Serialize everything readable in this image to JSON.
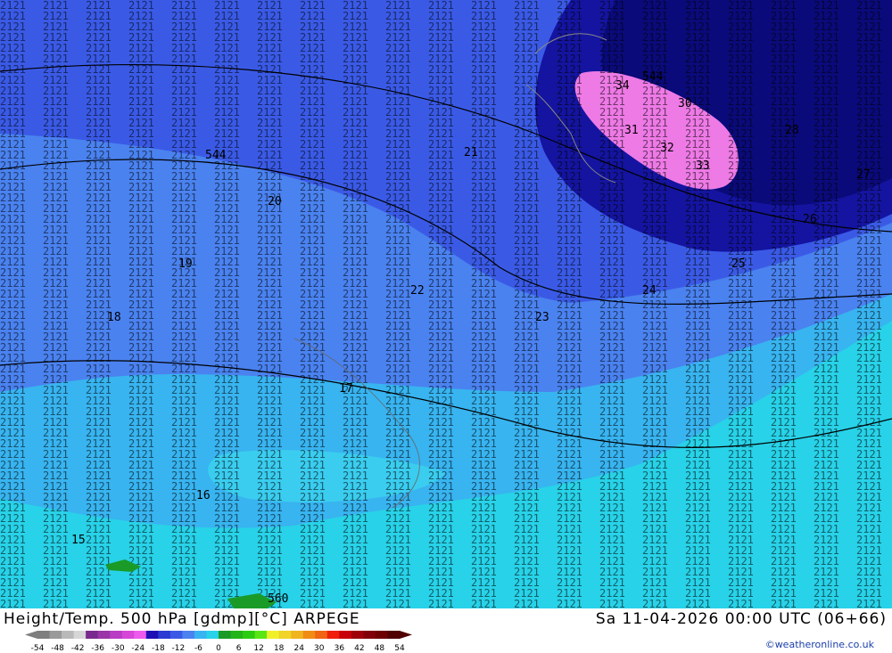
{
  "title": "Height/Temp. 500 hPa [gdmp][°C] ARPEGE",
  "datetime": "Sa 11-04-2026 00:00 UTC (06+66)",
  "credit": "©weatheronline.co.uk",
  "legend": {
    "ticks": [
      "-54",
      "-48",
      "-42",
      "-36",
      "-30",
      "-24",
      "-18",
      "-12",
      "-6",
      "0",
      "6",
      "12",
      "18",
      "24",
      "30",
      "36",
      "42",
      "48",
      "54"
    ],
    "colors": [
      "#7e7e7e",
      "#9a9a9a",
      "#b9b9b9",
      "#d6d6d6",
      "#7a2a8e",
      "#9a36a8",
      "#b83cc4",
      "#d646d8",
      "#ee5aee",
      "#1e0fb4",
      "#2a3ad2",
      "#3a5ae6",
      "#4a82f0",
      "#38b4f0",
      "#28d2e8",
      "#1a9b28",
      "#22b418",
      "#2ccc10",
      "#5ae614",
      "#f0f028",
      "#f0d428",
      "#f0b41e",
      "#f08c14",
      "#f06414",
      "#f01e0a",
      "#c8000a",
      "#a0000a",
      "#82000a",
      "#6e0000",
      "#500000"
    ]
  },
  "contour_labels": [
    "21",
    "20",
    "19",
    "18",
    "17",
    "16",
    "15",
    "22",
    "23",
    "24",
    "25",
    "26",
    "27",
    "28",
    "29",
    "30",
    "31",
    "32",
    "33",
    "34",
    "544",
    "560"
  ],
  "colors": {
    "deep_blue": "#1414a0",
    "navy": "#0a0a7a",
    "blue": "#3a5ae6",
    "light_blue": "#4a82f0",
    "sky": "#38b4f0",
    "cyan": "#28d2e8",
    "aqua": "#3ce6ee",
    "pink": "#ee7ae6",
    "green": "#1a9b28"
  }
}
